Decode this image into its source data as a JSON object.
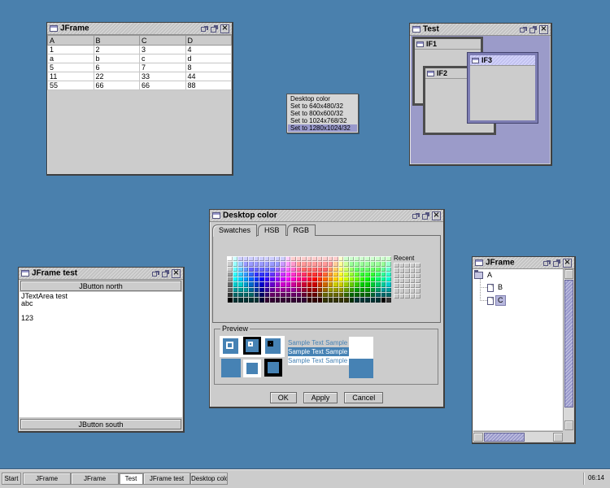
{
  "colors": {
    "desktop_background": "#4a80ad",
    "control": "#cccccc",
    "selection": "#9999cc",
    "accent_dark": "#666699",
    "active_internal_title": "#ccccff",
    "current_color": "#4682b4"
  },
  "windows": {
    "table_frame": {
      "title": "JFrame",
      "table": {
        "columns": [
          "A",
          "B",
          "C",
          "D"
        ],
        "rows": [
          [
            "1",
            "2",
            "3",
            "4"
          ],
          [
            "a",
            "b",
            "c",
            "d"
          ],
          [
            "5",
            "6",
            "7",
            "8"
          ],
          [
            "11",
            "22",
            "33",
            "44"
          ],
          [
            "55",
            "66",
            "66",
            "88"
          ]
        ]
      }
    },
    "test_frame": {
      "title": "Test",
      "internal_frames": [
        {
          "title": "IF1",
          "active": false
        },
        {
          "title": "IF2",
          "active": false
        },
        {
          "title": "IF3",
          "active": true
        }
      ]
    },
    "color_chooser": {
      "title": "Desktop color",
      "tabs": [
        "Swatches",
        "HSB",
        "RGB"
      ],
      "selected_tab": "Swatches",
      "recent_label": "Recent",
      "preview_label": "Preview",
      "sample_text": "Sample Text Sample Text",
      "buttons": [
        "OK",
        "Apply",
        "Cancel"
      ],
      "selected_color": "#4682b4",
      "palette_rows": [
        [
          "#FFF",
          "#CFF",
          "#CCF",
          "#CCF",
          "#CCF",
          "#CCF",
          "#CCF",
          "#CCF",
          "#CCF",
          "#CCF",
          "#CCF",
          "#FCF",
          "#FCC",
          "#FCC",
          "#FCC",
          "#FCC",
          "#FCC",
          "#FCC",
          "#FCC",
          "#FCC",
          "#FCC",
          "#FFC",
          "#CFC",
          "#CFC",
          "#CFC",
          "#CFC",
          "#CFC",
          "#CFC",
          "#CFC",
          "#CFC",
          "#CFC"
        ],
        [
          "#CCC",
          "#9FF",
          "#9CF",
          "#99F",
          "#99F",
          "#99F",
          "#99F",
          "#99F",
          "#99F",
          "#99F",
          "#C9F",
          "#F9F",
          "#F9C",
          "#F99",
          "#F99",
          "#F99",
          "#F99",
          "#F99",
          "#F99",
          "#F99",
          "#FC9",
          "#FF9",
          "#CF9",
          "#9F9",
          "#9F9",
          "#9F9",
          "#9F9",
          "#9F9",
          "#9F9",
          "#9F9",
          "#9FC"
        ],
        [
          "#CCC",
          "#6FF",
          "#6CF",
          "#69F",
          "#66F",
          "#66F",
          "#66F",
          "#66F",
          "#66F",
          "#96F",
          "#C6F",
          "#F6F",
          "#F6C",
          "#F69",
          "#F66",
          "#F66",
          "#F66",
          "#F66",
          "#F66",
          "#F96",
          "#FC6",
          "#FF6",
          "#CF6",
          "#9F6",
          "#6F6",
          "#6F6",
          "#6F6",
          "#6F6",
          "#6F6",
          "#6F9",
          "#6FC"
        ],
        [
          "#999",
          "#3FF",
          "#3CF",
          "#39F",
          "#36F",
          "#33F",
          "#33F",
          "#33F",
          "#63F",
          "#93F",
          "#C3F",
          "#F3F",
          "#F3C",
          "#F39",
          "#F36",
          "#F33",
          "#F33",
          "#F33",
          "#F63",
          "#F93",
          "#FC3",
          "#FF3",
          "#CF3",
          "#9F3",
          "#6F3",
          "#3F3",
          "#3F3",
          "#3F3",
          "#3F6",
          "#3F9",
          "#3FC"
        ],
        [
          "#999",
          "#0FF",
          "#0CF",
          "#09F",
          "#06F",
          "#03F",
          "#00F",
          "#30F",
          "#60F",
          "#90F",
          "#C0F",
          "#F0F",
          "#F0C",
          "#F09",
          "#F06",
          "#F03",
          "#F00",
          "#F30",
          "#F60",
          "#F90",
          "#FC0",
          "#FF0",
          "#CF0",
          "#9F0",
          "#6F0",
          "#3F0",
          "#0F0",
          "#0F3",
          "#0F6",
          "#0F9",
          "#0FC"
        ],
        [
          "#666",
          "#0CC",
          "#0CC",
          "#09C",
          "#06C",
          "#03C",
          "#00C",
          "#30C",
          "#60C",
          "#90C",
          "#C0C",
          "#C0C",
          "#C09",
          "#C06",
          "#C03",
          "#C00",
          "#C00",
          "#C30",
          "#C60",
          "#C90",
          "#CC0",
          "#CC0",
          "#9C0",
          "#6C0",
          "#3C0",
          "#0C0",
          "#0C0",
          "#0C3",
          "#0C6",
          "#0C9",
          "#0CC"
        ],
        [
          "#666",
          "#099",
          "#099",
          "#099",
          "#069",
          "#039",
          "#009",
          "#309",
          "#609",
          "#909",
          "#909",
          "#909",
          "#909",
          "#906",
          "#903",
          "#900",
          "#900",
          "#930",
          "#960",
          "#990",
          "#990",
          "#990",
          "#690",
          "#390",
          "#090",
          "#090",
          "#090",
          "#093",
          "#096",
          "#099",
          "#099"
        ],
        [
          "#333",
          "#066",
          "#066",
          "#066",
          "#066",
          "#036",
          "#006",
          "#306",
          "#606",
          "#606",
          "#606",
          "#606",
          "#606",
          "#606",
          "#603",
          "#600",
          "#600",
          "#630",
          "#660",
          "#660",
          "#660",
          "#660",
          "#360",
          "#060",
          "#060",
          "#060",
          "#060",
          "#063",
          "#066",
          "#066",
          "#066"
        ],
        [
          "#000",
          "#033",
          "#033",
          "#033",
          "#033",
          "#033",
          "#003",
          "#303",
          "#303",
          "#303",
          "#303",
          "#303",
          "#303",
          "#303",
          "#303",
          "#300",
          "#300",
          "#300",
          "#330",
          "#330",
          "#330",
          "#330",
          "#330",
          "#030",
          "#033",
          "#033",
          "#033",
          "#033",
          "#033",
          "#000",
          "#333"
        ]
      ],
      "recent_grid": {
        "columns": 5,
        "rows": 7
      }
    },
    "jframe_test": {
      "title": "JFrame test",
      "north_button": "JButton north",
      "textarea_lines": [
        "JTextArea test",
        "abc",
        "",
        "123"
      ],
      "south_button": "JButton south"
    },
    "tree_frame": {
      "title": "JFrame",
      "nodes": [
        {
          "label": "A",
          "level": 0,
          "selected": false
        },
        {
          "label": "B",
          "level": 1,
          "selected": false
        },
        {
          "label": "C",
          "level": 1,
          "selected": true
        }
      ]
    }
  },
  "context_menu": {
    "items": [
      {
        "label": "Desktop color",
        "selected": false
      },
      {
        "label": "Set to 640x480/32",
        "selected": false
      },
      {
        "label": "Set to 800x600/32",
        "selected": false
      },
      {
        "label": "Set to 1024x768/32",
        "selected": false
      },
      {
        "label": "Set to 1280x1024/32",
        "selected": true
      }
    ]
  },
  "taskbar": {
    "start_label": "Start",
    "tasks": [
      {
        "label": "JFrame",
        "active": false
      },
      {
        "label": "JFrame",
        "active": false
      },
      {
        "label": "Test",
        "active": true
      },
      {
        "label": "JFrame test",
        "active": false
      },
      {
        "label": "Desktop color",
        "active": false
      }
    ],
    "clock": "06:14"
  }
}
